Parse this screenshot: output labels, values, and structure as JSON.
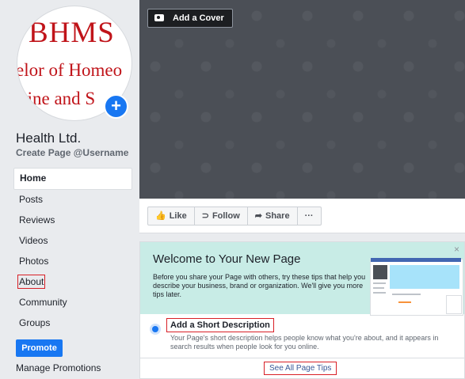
{
  "sidebar": {
    "logo": {
      "main": "BHMS",
      "line1": "elor of Homeo",
      "line2": "icine and S"
    },
    "page_name": "Health Ltd.",
    "username_cta": "Create Page @Username",
    "nav": [
      "Home",
      "Posts",
      "Reviews",
      "Videos",
      "Photos",
      "About",
      "Community",
      "Groups"
    ],
    "active": "Home",
    "promote": "Promote",
    "manage_promotions": "Manage Promotions"
  },
  "cover": {
    "add_cover": "Add a Cover"
  },
  "actions": {
    "like": "Like",
    "follow": "Follow",
    "share": "Share",
    "more": "···"
  },
  "welcome": {
    "title": "Welcome to Your New Page",
    "text": "Before you share your Page with others, try these tips that help you describe your business, brand or organization. We'll give you more tips later.",
    "close": "×",
    "tip_title": "Add a Short Description",
    "tip_text": "Your Page's short description helps people know what you're about, and it appears in search results when people look for you online.",
    "see_all": "See All Page Tips"
  },
  "colors": {
    "accent": "#1877f2",
    "highlight_box": "#d81f26",
    "welcome_bg": "#c8ece6"
  }
}
